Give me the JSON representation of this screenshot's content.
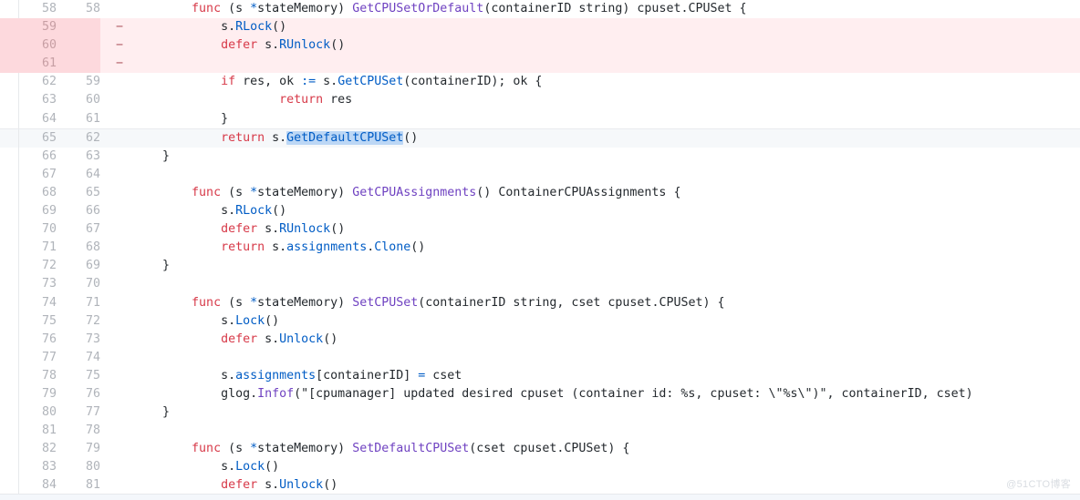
{
  "view": {
    "type": "unified-diff",
    "language": "go",
    "colors": {
      "background": "#ffffff",
      "deleted_row": "#ffeef0",
      "deleted_gutter": "#fdd9dd",
      "selected_row": "#f6f8fa",
      "token_highlight": "#bcd7f5",
      "keyword": "#d73a49",
      "function": "#6f42c1",
      "method": "#005cc5",
      "plain": "#24292e",
      "line_number": "#b0b4ba"
    },
    "watermark": "@51CTO博客"
  },
  "rows": [
    {
      "old": "58",
      "new": "58",
      "marker": "",
      "kind": "context",
      "tokens": [
        {
          "t": "        ",
          "c": "pl"
        },
        {
          "t": "func",
          "c": "kw"
        },
        {
          "t": " (s ",
          "c": "pl"
        },
        {
          "t": "*",
          "c": "mt"
        },
        {
          "t": "stateMemory) ",
          "c": "pl"
        },
        {
          "t": "GetCPUSetOrDefault",
          "c": "fn"
        },
        {
          "t": "(containerID string) cpuset.CPUSet {",
          "c": "pl"
        }
      ]
    },
    {
      "old": "59",
      "new": "",
      "marker": "−",
      "kind": "deleted",
      "tokens": [
        {
          "t": "            s.",
          "c": "pl"
        },
        {
          "t": "RLock",
          "c": "mt"
        },
        {
          "t": "()",
          "c": "pl"
        }
      ]
    },
    {
      "old": "60",
      "new": "",
      "marker": "−",
      "kind": "deleted",
      "tokens": [
        {
          "t": "            ",
          "c": "pl"
        },
        {
          "t": "defer",
          "c": "kw"
        },
        {
          "t": " s.",
          "c": "pl"
        },
        {
          "t": "RUnlock",
          "c": "mt"
        },
        {
          "t": "()",
          "c": "pl"
        }
      ]
    },
    {
      "old": "61",
      "new": "",
      "marker": "−",
      "kind": "deleted",
      "tokens": [
        {
          "t": "",
          "c": "pl"
        }
      ]
    },
    {
      "old": "62",
      "new": "59",
      "marker": "",
      "kind": "context",
      "tokens": [
        {
          "t": "            ",
          "c": "pl"
        },
        {
          "t": "if",
          "c": "kw"
        },
        {
          "t": " res, ok ",
          "c": "pl"
        },
        {
          "t": ":=",
          "c": "mt"
        },
        {
          "t": " s.",
          "c": "pl"
        },
        {
          "t": "GetCPUSet",
          "c": "mt"
        },
        {
          "t": "(containerID); ok {",
          "c": "pl"
        }
      ]
    },
    {
      "old": "63",
      "new": "60",
      "marker": "",
      "kind": "context",
      "tokens": [
        {
          "t": "                    ",
          "c": "pl"
        },
        {
          "t": "return",
          "c": "kw"
        },
        {
          "t": " res",
          "c": "pl"
        }
      ]
    },
    {
      "old": "64",
      "new": "61",
      "marker": "",
      "kind": "context",
      "tokens": [
        {
          "t": "            }",
          "c": "pl"
        }
      ]
    },
    {
      "old": "65",
      "new": "62",
      "marker": "",
      "kind": "selected",
      "tokens": [
        {
          "t": "            ",
          "c": "pl"
        },
        {
          "t": "return",
          "c": "kw"
        },
        {
          "t": " s.",
          "c": "pl"
        },
        {
          "t": "GetDefaultCPUSet",
          "c": "mt",
          "hl": true
        },
        {
          "t": "()",
          "c": "pl"
        }
      ]
    },
    {
      "old": "66",
      "new": "63",
      "marker": "",
      "kind": "context",
      "tokens": [
        {
          "t": "    }",
          "c": "pl"
        }
      ]
    },
    {
      "old": "67",
      "new": "64",
      "marker": "",
      "kind": "context",
      "tokens": [
        {
          "t": "",
          "c": "pl"
        }
      ]
    },
    {
      "old": "68",
      "new": "65",
      "marker": "",
      "kind": "context",
      "tokens": [
        {
          "t": "        ",
          "c": "pl"
        },
        {
          "t": "func",
          "c": "kw"
        },
        {
          "t": " (s ",
          "c": "pl"
        },
        {
          "t": "*",
          "c": "mt"
        },
        {
          "t": "stateMemory) ",
          "c": "pl"
        },
        {
          "t": "GetCPUAssignments",
          "c": "fn"
        },
        {
          "t": "() ContainerCPUAssignments {",
          "c": "pl"
        }
      ]
    },
    {
      "old": "69",
      "new": "66",
      "marker": "",
      "kind": "context",
      "tokens": [
        {
          "t": "            s.",
          "c": "pl"
        },
        {
          "t": "RLock",
          "c": "mt"
        },
        {
          "t": "()",
          "c": "pl"
        }
      ]
    },
    {
      "old": "70",
      "new": "67",
      "marker": "",
      "kind": "context",
      "tokens": [
        {
          "t": "            ",
          "c": "pl"
        },
        {
          "t": "defer",
          "c": "kw"
        },
        {
          "t": " s.",
          "c": "pl"
        },
        {
          "t": "RUnlock",
          "c": "mt"
        },
        {
          "t": "()",
          "c": "pl"
        }
      ]
    },
    {
      "old": "71",
      "new": "68",
      "marker": "",
      "kind": "context",
      "tokens": [
        {
          "t": "            ",
          "c": "pl"
        },
        {
          "t": "return",
          "c": "kw"
        },
        {
          "t": " s.",
          "c": "pl"
        },
        {
          "t": "assignments",
          "c": "mt"
        },
        {
          "t": ".",
          "c": "pl"
        },
        {
          "t": "Clone",
          "c": "mt"
        },
        {
          "t": "()",
          "c": "pl"
        }
      ]
    },
    {
      "old": "72",
      "new": "69",
      "marker": "",
      "kind": "context",
      "tokens": [
        {
          "t": "    }",
          "c": "pl"
        }
      ]
    },
    {
      "old": "73",
      "new": "70",
      "marker": "",
      "kind": "context",
      "tokens": [
        {
          "t": "",
          "c": "pl"
        }
      ]
    },
    {
      "old": "74",
      "new": "71",
      "marker": "",
      "kind": "context",
      "tokens": [
        {
          "t": "        ",
          "c": "pl"
        },
        {
          "t": "func",
          "c": "kw"
        },
        {
          "t": " (s ",
          "c": "pl"
        },
        {
          "t": "*",
          "c": "mt"
        },
        {
          "t": "stateMemory) ",
          "c": "pl"
        },
        {
          "t": "SetCPUSet",
          "c": "fn"
        },
        {
          "t": "(containerID string, cset cpuset.CPUSet) {",
          "c": "pl"
        }
      ]
    },
    {
      "old": "75",
      "new": "72",
      "marker": "",
      "kind": "context",
      "tokens": [
        {
          "t": "            s.",
          "c": "pl"
        },
        {
          "t": "Lock",
          "c": "mt"
        },
        {
          "t": "()",
          "c": "pl"
        }
      ]
    },
    {
      "old": "76",
      "new": "73",
      "marker": "",
      "kind": "context",
      "tokens": [
        {
          "t": "            ",
          "c": "pl"
        },
        {
          "t": "defer",
          "c": "kw"
        },
        {
          "t": " s.",
          "c": "pl"
        },
        {
          "t": "Unlock",
          "c": "mt"
        },
        {
          "t": "()",
          "c": "pl"
        }
      ]
    },
    {
      "old": "77",
      "new": "74",
      "marker": "",
      "kind": "context",
      "tokens": [
        {
          "t": "",
          "c": "pl"
        }
      ]
    },
    {
      "old": "78",
      "new": "75",
      "marker": "",
      "kind": "context",
      "tokens": [
        {
          "t": "            s.",
          "c": "pl"
        },
        {
          "t": "assignments",
          "c": "mt"
        },
        {
          "t": "[containerID] ",
          "c": "pl"
        },
        {
          "t": "=",
          "c": "mt"
        },
        {
          "t": " cset",
          "c": "pl"
        }
      ]
    },
    {
      "old": "79",
      "new": "76",
      "marker": "",
      "kind": "context",
      "tokens": [
        {
          "t": "            glog.",
          "c": "pl"
        },
        {
          "t": "Infof",
          "c": "fn"
        },
        {
          "t": "(\"[cpumanager] updated desired cpuset (container id: %s, cpuset: \\\"%s\\\")\", containerID, cset)",
          "c": "st"
        }
      ]
    },
    {
      "old": "80",
      "new": "77",
      "marker": "",
      "kind": "context",
      "tokens": [
        {
          "t": "    }",
          "c": "pl"
        }
      ]
    },
    {
      "old": "81",
      "new": "78",
      "marker": "",
      "kind": "context",
      "tokens": [
        {
          "t": "",
          "c": "pl"
        }
      ]
    },
    {
      "old": "82",
      "new": "79",
      "marker": "",
      "kind": "context",
      "tokens": [
        {
          "t": "        ",
          "c": "pl"
        },
        {
          "t": "func",
          "c": "kw"
        },
        {
          "t": " (s ",
          "c": "pl"
        },
        {
          "t": "*",
          "c": "mt"
        },
        {
          "t": "stateMemory) ",
          "c": "pl"
        },
        {
          "t": "SetDefaultCPUSet",
          "c": "fn"
        },
        {
          "t": "(cset cpuset.CPUSet) {",
          "c": "pl"
        }
      ]
    },
    {
      "old": "83",
      "new": "80",
      "marker": "",
      "kind": "context",
      "tokens": [
        {
          "t": "            s.",
          "c": "pl"
        },
        {
          "t": "Lock",
          "c": "mt"
        },
        {
          "t": "()",
          "c": "pl"
        }
      ]
    },
    {
      "old": "84",
      "new": "81",
      "marker": "",
      "kind": "context",
      "tokens": [
        {
          "t": "            ",
          "c": "pl"
        },
        {
          "t": "defer",
          "c": "kw"
        },
        {
          "t": " s.",
          "c": "pl"
        },
        {
          "t": "Unlock",
          "c": "mt"
        },
        {
          "t": "()",
          "c": "pl"
        }
      ]
    }
  ]
}
